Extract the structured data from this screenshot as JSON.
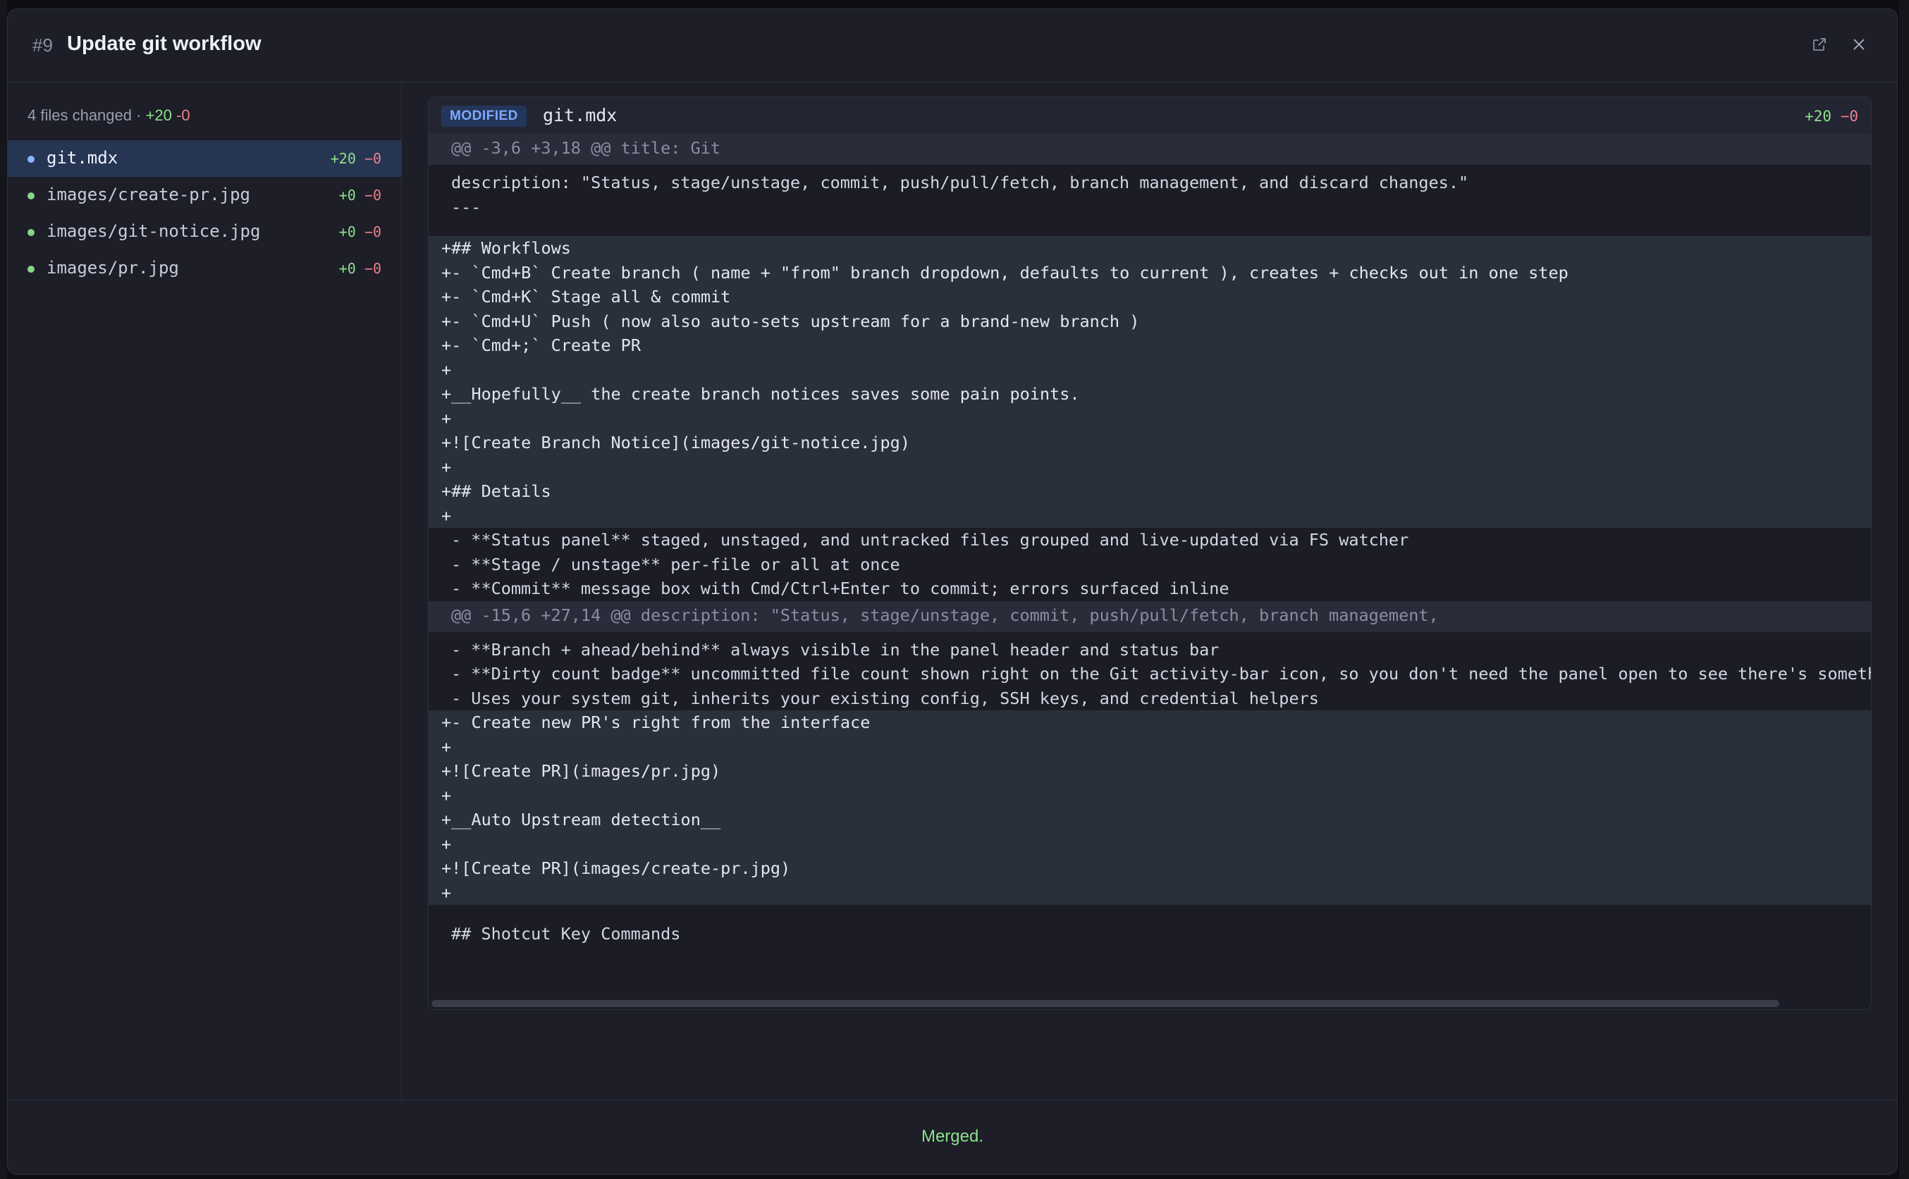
{
  "header": {
    "pr_number": "#9",
    "title": "Update git workflow",
    "open_external_icon": "external-link-icon",
    "close_icon": "close-icon"
  },
  "sidebar": {
    "summary_prefix": "4 files changed ·",
    "summary_add": "+20",
    "summary_del": "-0",
    "files": [
      {
        "name": "git.mdx",
        "add": "+20",
        "del": "−0",
        "active": true
      },
      {
        "name": "images/create-pr.jpg",
        "add": "+0",
        "del": "−0",
        "active": false
      },
      {
        "name": "images/git-notice.jpg",
        "add": "+0",
        "del": "−0",
        "active": false
      },
      {
        "name": "images/pr.jpg",
        "add": "+0",
        "del": "−0",
        "active": false
      }
    ]
  },
  "diff": {
    "status": "MODIFIED",
    "filename": "git.mdx",
    "add": "+20",
    "del": "−0",
    "lines": [
      {
        "type": "hunk",
        "text": "@@ -3,6 +3,18 @@ title: Git"
      },
      {
        "type": "ctx",
        "text": "description: \"Status, stage/unstage, commit, push/pull/fetch, branch management, and discard changes.\""
      },
      {
        "type": "ctx",
        "text": "---"
      },
      {
        "type": "ctx",
        "text": ""
      },
      {
        "type": "add",
        "text": "+## Workflows"
      },
      {
        "type": "add",
        "text": "+- `Cmd+B` Create branch ( name + \"from\" branch dropdown, defaults to current ), creates + checks out in one step"
      },
      {
        "type": "add",
        "text": "+- `Cmd+K` Stage all & commit"
      },
      {
        "type": "add",
        "text": "+- `Cmd+U` Push ( now also auto-sets upstream for a brand-new branch )"
      },
      {
        "type": "add",
        "text": "+- `Cmd+;` Create PR"
      },
      {
        "type": "add",
        "text": "+"
      },
      {
        "type": "add",
        "text": "+__Hopefully__ the create branch notices saves some pain points."
      },
      {
        "type": "add",
        "text": "+"
      },
      {
        "type": "add",
        "text": "+![Create Branch Notice](images/git-notice.jpg)"
      },
      {
        "type": "add",
        "text": "+"
      },
      {
        "type": "add",
        "text": "+## Details"
      },
      {
        "type": "add",
        "text": "+"
      },
      {
        "type": "ctx",
        "text": "- **Status panel** staged, unstaged, and untracked files grouped and live-updated via FS watcher"
      },
      {
        "type": "ctx",
        "text": "- **Stage / unstage** per-file or all at once"
      },
      {
        "type": "ctx",
        "text": "- **Commit** message box with Cmd/Ctrl+Enter to commit; errors surfaced inline"
      },
      {
        "type": "hunk",
        "text": "@@ -15,6 +27,14 @@ description: \"Status, stage/unstage, commit, push/pull/fetch, branch management,"
      },
      {
        "type": "ctx",
        "text": "- **Branch + ahead/behind** always visible in the panel header and status bar"
      },
      {
        "type": "ctx",
        "text": "- **Dirty count badge** uncommitted file count shown right on the Git activity-bar icon, so you don't need the panel open to see there's something"
      },
      {
        "type": "ctx",
        "text": "- Uses your system git, inherits your existing config, SSH keys, and credential helpers"
      },
      {
        "type": "add",
        "text": "+- Create new PR's right from the interface"
      },
      {
        "type": "add",
        "text": "+"
      },
      {
        "type": "add",
        "text": "+![Create PR](images/pr.jpg)"
      },
      {
        "type": "add",
        "text": "+"
      },
      {
        "type": "add",
        "text": "+__Auto Upstream detection__"
      },
      {
        "type": "add",
        "text": "+"
      },
      {
        "type": "add",
        "text": "+![Create PR](images/create-pr.jpg)"
      },
      {
        "type": "add",
        "text": "+"
      },
      {
        "type": "ctx",
        "text": ""
      },
      {
        "type": "ctx",
        "text": "## Shotcut Key Commands"
      }
    ]
  },
  "footer": {
    "status": "Merged."
  },
  "colors": {
    "added": "#8ee08e",
    "removed": "#f07f8c",
    "badge_text": "#7fa9ff",
    "active_file_bg": "#263552"
  }
}
